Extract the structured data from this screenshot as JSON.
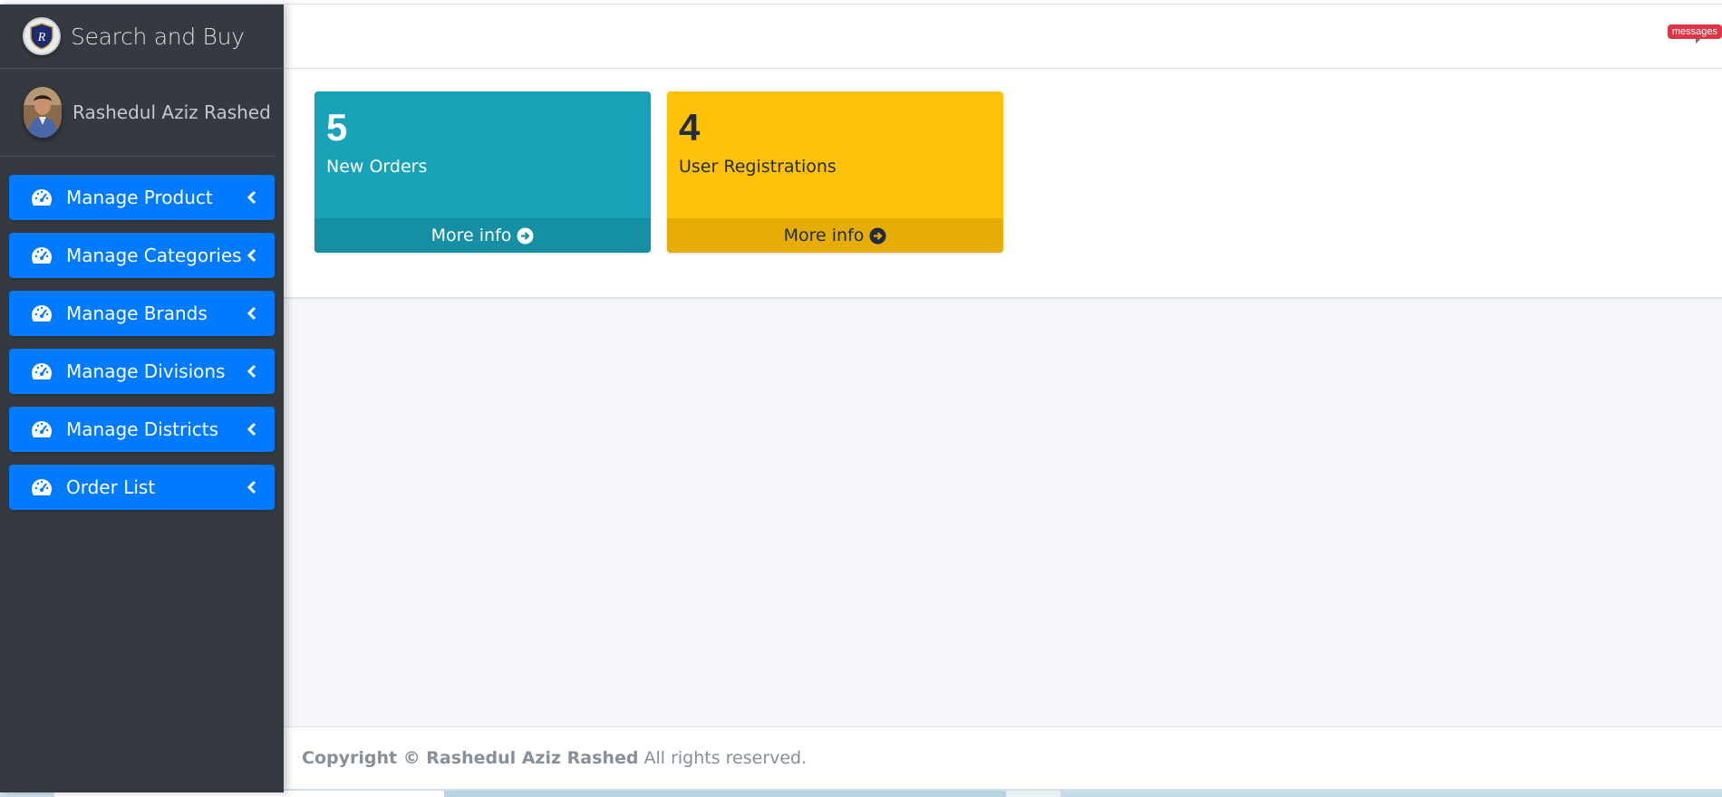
{
  "app": {
    "brand_name": "Search and Buy",
    "brand_logo_icon": "shield-logo-icon"
  },
  "user": {
    "name": "Rashedul Aziz Rashed"
  },
  "sidebar": {
    "items": [
      {
        "label": "Manage Product",
        "icon": "tachometer-icon"
      },
      {
        "label": "Manage Categories",
        "icon": "tachometer-icon"
      },
      {
        "label": "Manage Brands",
        "icon": "tachometer-icon"
      },
      {
        "label": "Manage Divisions",
        "icon": "tachometer-icon"
      },
      {
        "label": "Manage Districts",
        "icon": "tachometer-icon"
      },
      {
        "label": "Order List",
        "icon": "tachometer-icon"
      }
    ]
  },
  "navbar": {
    "messages_badge": "messages",
    "messages_icon": "comments-icon"
  },
  "stats": {
    "new_orders": {
      "count": "5",
      "label": "New Orders",
      "more": "More info",
      "color": "#17a2b8"
    },
    "user_registrations": {
      "count": "4",
      "label": "User Registrations",
      "more": "More info",
      "color": "#ffc107"
    }
  },
  "footer": {
    "copyright": "Copyright © Rashedul Aziz Rashed",
    "rights": "All rights reserved."
  },
  "colors": {
    "sidebar_bg": "#343a40",
    "nav_item_bg": "#007bff",
    "content_bg": "#f4f6f9",
    "badge_red": "#dc3545"
  }
}
